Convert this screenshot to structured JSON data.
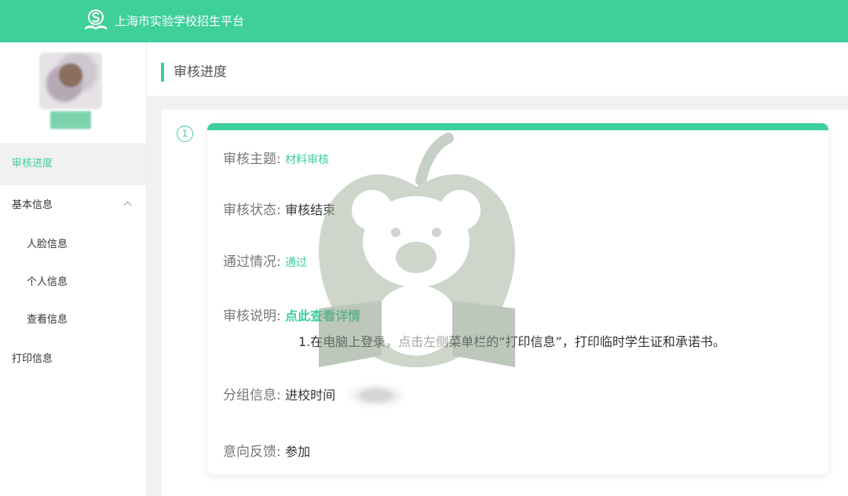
{
  "app": {
    "title": "上海市实验学校招生平台"
  },
  "colors": {
    "accent": "#3ecf9b"
  },
  "sidebar": {
    "items": [
      {
        "label": "审核进度",
        "active": true
      },
      {
        "label": "基本信息",
        "expanded": true
      },
      {
        "label": "人脸信息",
        "sub": true
      },
      {
        "label": "个人信息",
        "sub": true
      },
      {
        "label": "查看信息",
        "sub": true
      },
      {
        "label": "打印信息"
      }
    ]
  },
  "page": {
    "title": "审核进度"
  },
  "step": {
    "number": "1"
  },
  "review": {
    "subject_label": "审核主题:",
    "subject_value": "材料审核",
    "status_label": "审核状态:",
    "status_value": "审核结束",
    "pass_label": "通过情况:",
    "pass_value": "通过",
    "note_label": "审核说明:",
    "note_link": "点此查看详情",
    "note_text": "1.在电脑上登录，点击左侧菜单栏的“打印信息”，打印临时学生证和承诺书。",
    "group_label": "分组信息:",
    "group_value": "进校时间",
    "feedback_label": "意向反馈:",
    "feedback_value": "参加"
  }
}
